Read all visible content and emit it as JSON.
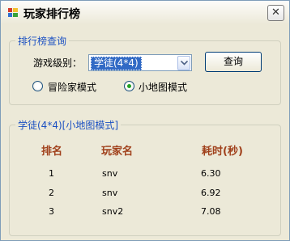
{
  "window": {
    "title": "玩家排行榜",
    "close_symbol": "✕"
  },
  "query_group": {
    "legend": "排行榜查询",
    "level_label": "游戏级别：",
    "level_selected": "学徒(4*4)",
    "query_button": "查询",
    "modes": [
      {
        "label": "冒险家模式",
        "selected": false
      },
      {
        "label": "小地图模式",
        "selected": true
      }
    ]
  },
  "results_group": {
    "legend": "学徒(4*4)[小地图模式]",
    "headers": {
      "rank": "排名",
      "player": "玩家名",
      "time": "耗时(秒)"
    },
    "rows": [
      {
        "rank": "1",
        "player": "snv",
        "time": "6.30"
      },
      {
        "rank": "2",
        "player": "snv",
        "time": "6.92"
      },
      {
        "rank": "3",
        "player": "snv2",
        "time": "7.08"
      }
    ]
  }
}
